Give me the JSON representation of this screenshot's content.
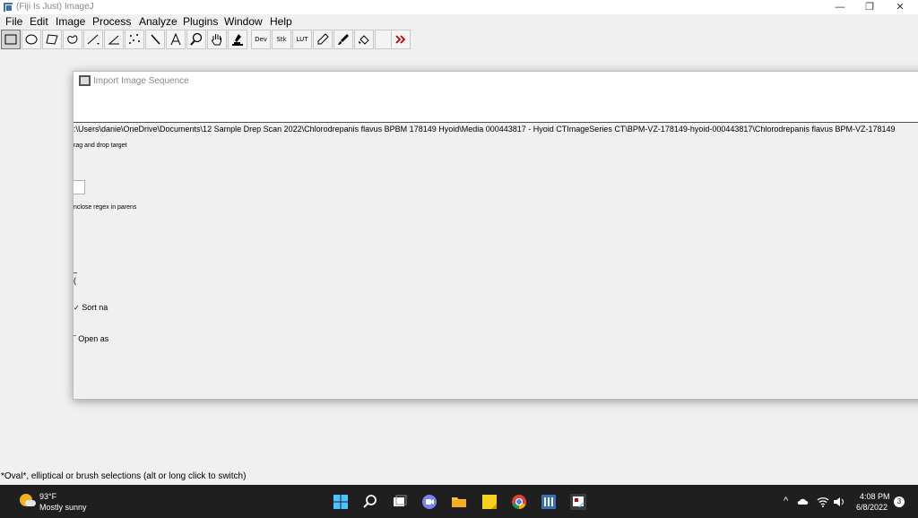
{
  "window": {
    "title": "(Fiji Is Just) ImageJ"
  },
  "menu": [
    "File",
    "Edit",
    "Image",
    "Process",
    "Analyze",
    "Plugins",
    "Window",
    "Help"
  ],
  "toolbar": {
    "dev_label": "Dev",
    "stk_label": "Stk",
    "lut_label": "LUT"
  },
  "dialog": {
    "title": "Import Image Sequence",
    "path": ":\\Users\\danie\\OneDrive\\Documents\\12 Sample Drep Scan 2022\\Chlorodrepanis flavus BPBM 178149 Hyoid\\Media 000443817 - Hyoid CTImageSeries CT\\BPM-VZ-178149-hyoid-000443817\\Chlorodrepanis flavus BPM-VZ-178149",
    "drag_hint": "rag and drop target",
    "regex_hint": "nclose regex in parens",
    "clipped_label": "(",
    "sort_label": "Sort na",
    "open_label": "Open as"
  },
  "status": "*Oval*, elliptical or brush selections (alt or long click to switch)",
  "taskbar": {
    "temperature": "93°F",
    "condition": "Mostly sunny",
    "time": "4:08 PM",
    "date": "6/8/2022",
    "notifications": "3"
  }
}
